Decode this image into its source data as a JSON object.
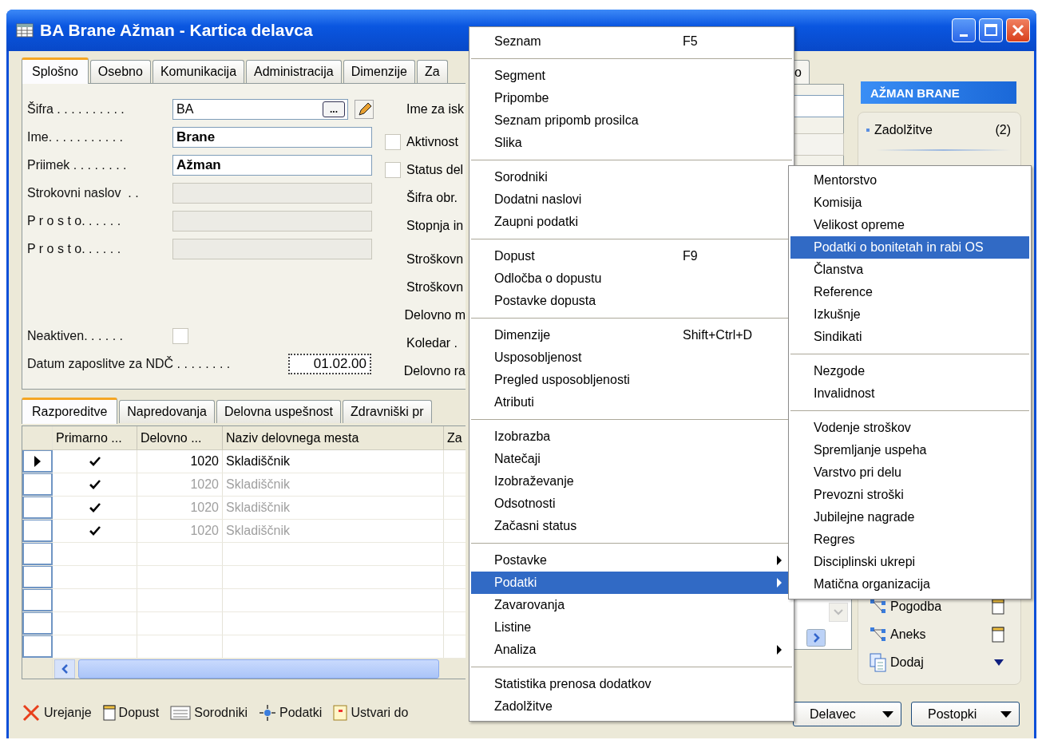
{
  "window": {
    "title": "BA Brane Ažman - Kartica delavca"
  },
  "tabs": [
    {
      "label": "Splošno",
      "selected": true
    },
    {
      "label": "Osebno",
      "selected": false
    },
    {
      "label": "Komunikacija",
      "selected": false
    },
    {
      "label": "Administracija",
      "selected": false
    },
    {
      "label": "Dimenzije",
      "selected": false
    },
    {
      "label": "Za",
      "selected": false
    }
  ],
  "tab_fragment": {
    "label": "o"
  },
  "fields": [
    {
      "kind": "lookup",
      "label": "Šifra . . . . . . . . . .",
      "value": "BA",
      "bold": false,
      "lookup_button": "..."
    },
    {
      "kind": "text",
      "label": "Ime. . . . . . . . . . .",
      "value": "Brane",
      "bold": true
    },
    {
      "kind": "text",
      "label": "Priimek . . . . . . . .",
      "value": "Ažman",
      "bold": true
    },
    {
      "kind": "disabled",
      "label": "Strokovni naslov  . ."
    },
    {
      "kind": "disabled",
      "label": "P r o s t o. . . . . ."
    },
    {
      "kind": "disabled",
      "label": "P r o s t o. . . . . ."
    },
    {
      "kind": "checkbox",
      "label": "Neaktiven. . . . . .",
      "checked": false
    },
    {
      "kind": "date",
      "label": "Datum zaposlitve za NDČ . . . . . . . .",
      "value": "01.02.00"
    }
  ],
  "side_fields": [
    {
      "kind": "label",
      "label": "Ime za isk"
    },
    {
      "kind": "checkbox",
      "label": "Aktivnost",
      "checked": false
    },
    {
      "kind": "checkbox",
      "label": "Status del",
      "checked": false
    },
    {
      "kind": "label",
      "label": "Šifra obr."
    },
    {
      "kind": "label",
      "label": "Stopnja in"
    },
    {
      "kind": "label",
      "label": "Stroškovn"
    },
    {
      "kind": "label",
      "label": "Stroškovn"
    },
    {
      "kind": "label",
      "label": "Delovno m"
    },
    {
      "kind": "label",
      "label": "Koledar ."
    },
    {
      "kind": "label",
      "label": "Delovno ra"
    }
  ],
  "lines_tabs": [
    {
      "label": "Razporeditve",
      "selected": true
    },
    {
      "label": "Napredovanja",
      "selected": false
    },
    {
      "label": "Delovna uspešnost",
      "selected": false
    },
    {
      "label": "Zdravniški pr",
      "selected": false
    }
  ],
  "table": {
    "columns": [
      "Primarno ...",
      "Delovno ...",
      "Naziv delovnega mesta",
      "Za"
    ],
    "rows": [
      {
        "current": true,
        "primary": true,
        "code": "1020",
        "name": "Skladiščnik"
      },
      {
        "current": false,
        "primary": true,
        "code": "1020",
        "name": "Skladiščnik"
      },
      {
        "current": false,
        "primary": true,
        "code": "1020",
        "name": "Skladiščnik"
      },
      {
        "current": false,
        "primary": true,
        "code": "1020",
        "name": "Skladiščnik"
      }
    ]
  },
  "toolbar": [
    {
      "kind": "cross",
      "label": "Urejanje"
    },
    {
      "kind": "page",
      "label": "Dopust"
    },
    {
      "kind": "card",
      "label": "Sorodniki"
    },
    {
      "kind": "move",
      "label": "Podatki"
    },
    {
      "kind": "note",
      "label": "Ustvari do"
    }
  ],
  "factbox": {
    "title": "AŽMAN BRANE",
    "items": [
      {
        "label": "Zadolžitve",
        "count": "(2)"
      }
    ],
    "actions": [
      {
        "kind": "link",
        "label": "Pogodba"
      },
      {
        "kind": "link",
        "label": "Aneks"
      },
      {
        "kind": "add",
        "label": "Dodaj"
      }
    ]
  },
  "buttons": [
    "Delavec",
    "Postopki"
  ],
  "menu": [
    [
      {
        "label": "Seznam",
        "shortcut": "F5",
        "submenu": false,
        "selected": false
      }
    ],
    [
      {
        "label": "Segment",
        "submenu": false,
        "selected": false
      },
      {
        "label": "Pripombe",
        "submenu": false,
        "selected": false
      },
      {
        "label": "Seznam pripomb prosilca",
        "submenu": false,
        "selected": false
      },
      {
        "label": "Slika",
        "submenu": false,
        "selected": false
      }
    ],
    [
      {
        "label": "Sorodniki",
        "submenu": false,
        "selected": false
      },
      {
        "label": "Dodatni naslovi",
        "submenu": false,
        "selected": false
      },
      {
        "label": "Zaupni podatki",
        "submenu": false,
        "selected": false
      }
    ],
    [
      {
        "label": "Dopust",
        "shortcut": "F9",
        "submenu": false,
        "selected": false
      },
      {
        "label": "Odločba o dopustu",
        "submenu": false,
        "selected": false
      },
      {
        "label": "Postavke dopusta",
        "submenu": false,
        "selected": false
      }
    ],
    [
      {
        "label": "Dimenzije",
        "shortcut": "Shift+Ctrl+D",
        "submenu": false,
        "selected": false
      },
      {
        "label": "Usposobljenost",
        "submenu": false,
        "selected": false
      },
      {
        "label": "Pregled usposobljenosti",
        "submenu": false,
        "selected": false
      },
      {
        "label": "Atributi",
        "submenu": false,
        "selected": false
      }
    ],
    [
      {
        "label": "Izobrazba",
        "submenu": false,
        "selected": false
      },
      {
        "label": "Natečaji",
        "submenu": false,
        "selected": false
      },
      {
        "label": "Izobraževanje",
        "submenu": false,
        "selected": false
      },
      {
        "label": "Odsotnosti",
        "submenu": false,
        "selected": false
      },
      {
        "label": "Začasni status",
        "submenu": false,
        "selected": false
      }
    ],
    [
      {
        "label": "Postavke",
        "submenu": true,
        "selected": false
      },
      {
        "label": "Podatki",
        "submenu": true,
        "selected": true
      },
      {
        "label": "Zavarovanja",
        "submenu": false,
        "selected": false
      },
      {
        "label": "Listine",
        "submenu": false,
        "selected": false
      },
      {
        "label": "Analiza",
        "submenu": true,
        "selected": false
      }
    ],
    [
      {
        "label": "Statistika prenosa dodatkov",
        "submenu": false,
        "selected": false
      },
      {
        "label": "Zadolžitve",
        "submenu": false,
        "selected": false
      }
    ]
  ],
  "submenu": [
    [
      {
        "label": "Mentorstvo",
        "selected": false
      },
      {
        "label": "Komisija",
        "selected": false
      },
      {
        "label": "Velikost opreme",
        "selected": false
      },
      {
        "label": "Podatki o bonitetah in rabi OS",
        "selected": true
      },
      {
        "label": "Članstva",
        "selected": false
      },
      {
        "label": "Reference",
        "selected": false
      },
      {
        "label": "Izkušnje",
        "selected": false
      },
      {
        "label": "Sindikati",
        "selected": false
      }
    ],
    [
      {
        "label": "Nezgode",
        "selected": false
      },
      {
        "label": "Invalidnost",
        "selected": false
      }
    ],
    [
      {
        "label": "Vodenje stroškov",
        "selected": false
      },
      {
        "label": "Spremljanje uspeha",
        "selected": false
      },
      {
        "label": "Varstvo pri delu",
        "selected": false
      },
      {
        "label": "Prevozni stroški",
        "selected": false
      },
      {
        "label": "Jubilejne nagrade",
        "selected": false
      },
      {
        "label": "Regres",
        "selected": false
      },
      {
        "label": "Disciplinski ukrepi",
        "selected": false
      },
      {
        "label": "Matična organizacija",
        "selected": false
      }
    ]
  ]
}
